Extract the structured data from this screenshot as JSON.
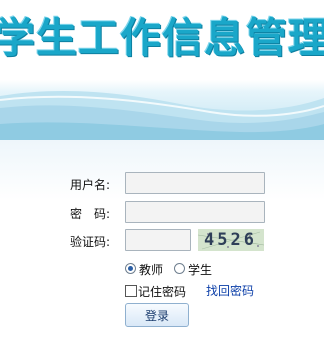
{
  "header": {
    "title": "学生工作信息管理"
  },
  "form": {
    "username_label": "用户名:",
    "password_label": "密　码:",
    "captcha_label": "验证码:",
    "username_value": "",
    "password_value": "",
    "captcha_value": "",
    "captcha_text": "4526",
    "role_options": [
      "教师",
      "学生"
    ],
    "role_selected": "教师",
    "remember_label": "记住密码",
    "remember_checked": false,
    "forgot_link": "找回密码",
    "login_button": "登录"
  },
  "colors": {
    "title": "#1aa7c9",
    "link": "#0b3ea8",
    "captcha_bg": "#cfe0c8"
  }
}
